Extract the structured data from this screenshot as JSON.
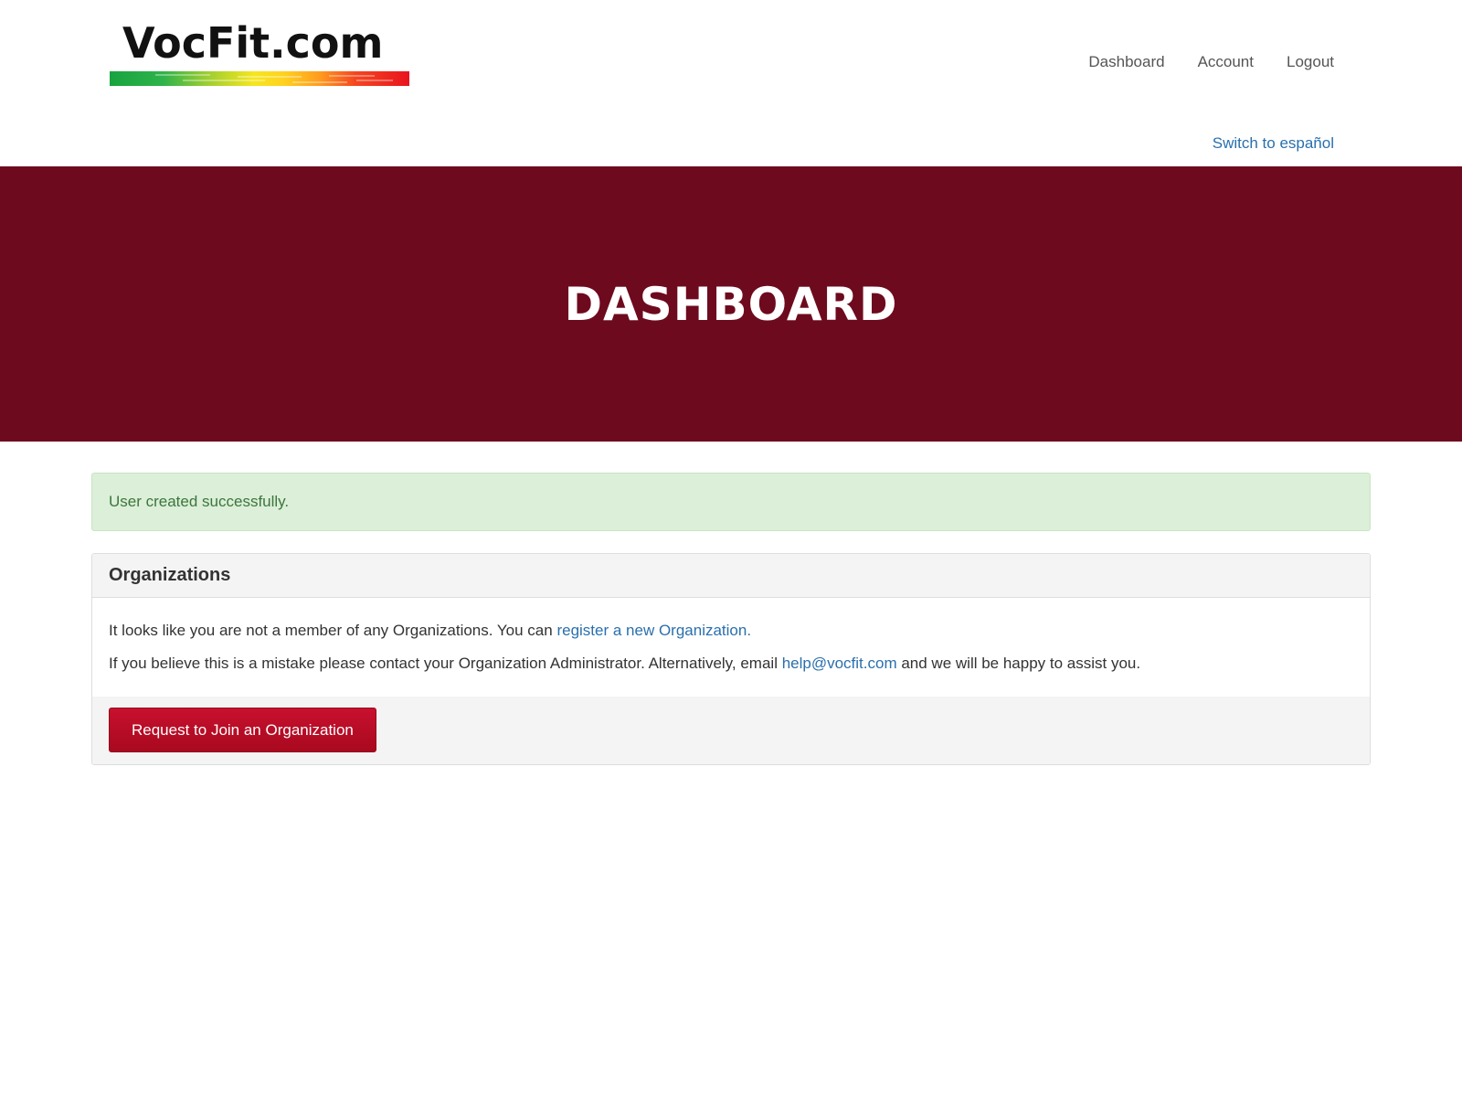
{
  "header": {
    "logo_text": "VocFit.com",
    "nav": [
      {
        "label": "Dashboard"
      },
      {
        "label": "Account"
      },
      {
        "label": "Logout"
      }
    ],
    "language_switch": "Switch to español"
  },
  "hero": {
    "title": "DASHBOARD"
  },
  "alert": {
    "message": "User created successfully."
  },
  "organizations_panel": {
    "title": "Organizations",
    "line1_prefix": "It looks like you are not a member of any Organizations. You can ",
    "line1_link": "register a new Organization.",
    "line2_prefix": "If you believe this is a mistake please contact your Organization Administrator. Alternatively, email ",
    "line2_link": "help@vocfit.com",
    "line2_suffix": " and we will be happy to assist you.",
    "button_label": "Request to Join an Organization"
  },
  "colors": {
    "hero_bg": "#6e0a1e",
    "link": "#2a6fad",
    "alert_bg": "#dcefd8",
    "alert_text": "#3c763d",
    "button_bg": "#c8102e"
  }
}
